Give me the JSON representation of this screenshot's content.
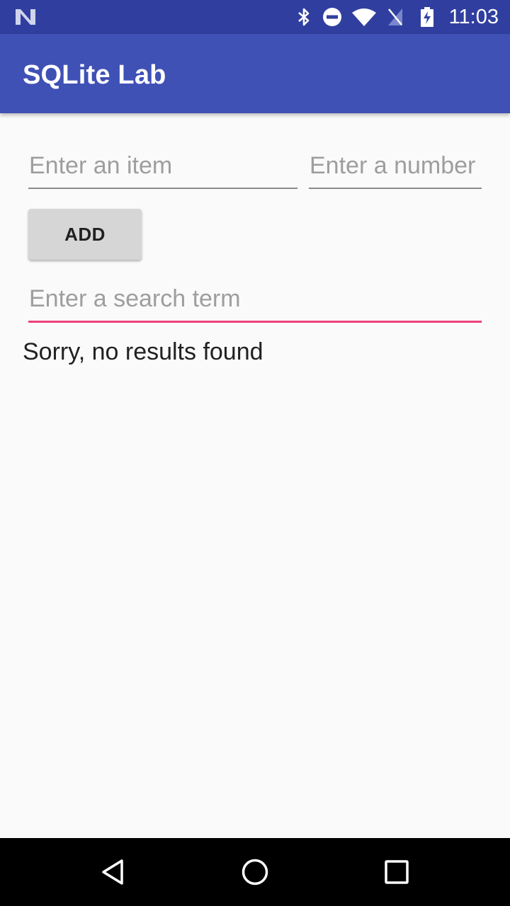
{
  "status_bar": {
    "clock": "11:03",
    "icons": [
      "n-logo-icon",
      "bluetooth-icon",
      "do-not-disturb-icon",
      "wifi-icon",
      "no-signal-icon",
      "battery-charging-icon"
    ]
  },
  "app_bar": {
    "title": "SQLite Lab",
    "color": "#3f51b5"
  },
  "form": {
    "item_placeholder": "Enter an item",
    "item_value": "",
    "number_placeholder": "Enter a number",
    "number_value": "",
    "add_label": "ADD",
    "search_placeholder": "Enter a search term",
    "search_value": "",
    "accent_color": "#ec407a"
  },
  "results": {
    "message": "Sorry, no results found"
  },
  "nav_bar": {
    "buttons": [
      "back-icon",
      "home-icon",
      "recents-icon"
    ]
  }
}
